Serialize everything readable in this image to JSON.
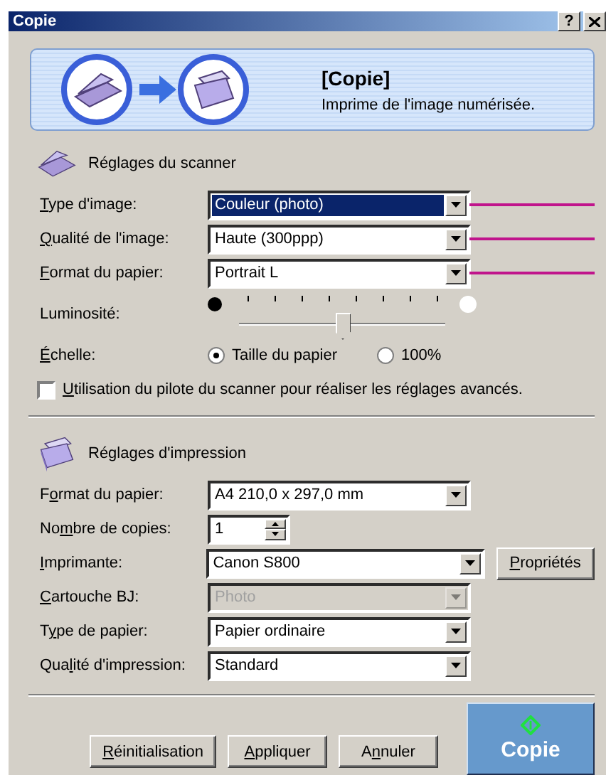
{
  "window": {
    "title": "Copie",
    "help": "?"
  },
  "banner": {
    "title": "[Copie]",
    "description": "Imprime de l'image numérisée."
  },
  "scanner": {
    "heading": "Réglages du scanner",
    "fields": [
      {
        "label": {
          "key": "T",
          "post": "ype d'image:"
        },
        "value": "Couleur (photo)",
        "focused": true,
        "callout": true
      },
      {
        "label": {
          "key": "Q",
          "post": "ualité de l'image:"
        },
        "value": "Haute (300ppp)",
        "focused": false,
        "callout": true
      },
      {
        "label": {
          "key": "F",
          "post": "ormat du papier:"
        },
        "value": "Portrait L",
        "focused": false,
        "callout": true
      }
    ],
    "brightness": {
      "label": {
        "post": "Luminosité:"
      },
      "level": 0.5
    },
    "scale": {
      "label": {
        "key": "É",
        "post": "chelle:"
      },
      "options": [
        {
          "label": "Taille du papier",
          "selected": true
        },
        {
          "label": "100%",
          "selected": false
        }
      ]
    },
    "driver": {
      "label": {
        "key": "U",
        "post": "tilisation du pilote du scanner pour réaliser les réglages avancés."
      },
      "checked": false
    }
  },
  "print": {
    "heading": "Réglages d'impression",
    "fields": [
      {
        "kind": "dropdown",
        "label": {
          "pre": "F",
          "key": "o",
          "post": "rmat du papier:"
        },
        "value": "A4 210,0 x 297,0 mm",
        "disabled": false
      },
      {
        "kind": "spinner",
        "label": {
          "pre": "No",
          "key": "m",
          "post": "bre de copies:"
        },
        "value": "1"
      },
      {
        "kind": "dropdown",
        "label": {
          "key": "I",
          "post": "mprimante:"
        },
        "value": "Canon S800",
        "disabled": false,
        "button": {
          "key": "P",
          "post": "ropriétés"
        }
      },
      {
        "kind": "dropdown",
        "label": {
          "key": "C",
          "post": "artouche BJ:"
        },
        "value": "Photo",
        "disabled": true
      },
      {
        "kind": "dropdown",
        "label": {
          "pre": "T",
          "key": "y",
          "post": "pe de papier:"
        },
        "value": "Papier ordinaire",
        "disabled": false
      },
      {
        "kind": "dropdown",
        "label": {
          "pre": "Qua",
          "key": "l",
          "post": "ité d'impression:"
        },
        "value": "Standard",
        "disabled": false
      }
    ]
  },
  "buttons": [
    {
      "kind": "normal",
      "label": {
        "key": "R",
        "post": "éinitialisation"
      }
    },
    {
      "kind": "normal",
      "label": {
        "key": "A",
        "post": "ppliquer"
      }
    },
    {
      "kind": "normal",
      "label": {
        "pre": "A",
        "key": "n",
        "post": "nuler"
      }
    },
    {
      "kind": "primary",
      "label": {
        "post": "Copie"
      }
    }
  ]
}
